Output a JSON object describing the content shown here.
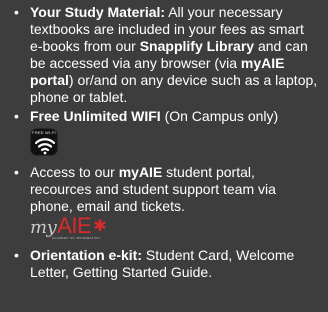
{
  "items": [
    {
      "bold_label": "Your Study Material:",
      "text_1": " All your necessary textbooks are included in your fees as smart e-books from our ",
      "bold_1": "Snapplify Library",
      "text_2": " and can be accessed via any browser (via ",
      "bold_2": "myAIE portal",
      "text_3": ") or/and on any device such as a laptop, phone or tablet."
    },
    {
      "bold_label": "Free Unlimited WIFI",
      "text_1": " (On Campus only)"
    },
    {
      "text_1": "Access to our ",
      "bold_1": "myAIE",
      "text_2": " student portal, recources and student support team via phone, email and tickets."
    },
    {
      "bold_label": "Orientation e-kit:",
      "text_1": " Student Card, Welcome Letter, Getting Started Guide."
    }
  ],
  "wifi_icon": {
    "icon": "wifi-icon",
    "text": "FREE WI-FI"
  },
  "logo": {
    "my": "my",
    "aie": "AIE",
    "mark": "✱",
    "sub": "ACADEMY OF INFORMATION"
  },
  "bullet": "•",
  "colors": {
    "background": "#3d3d3d",
    "text": "#ffffff",
    "logo_red": "#d92b2b"
  }
}
